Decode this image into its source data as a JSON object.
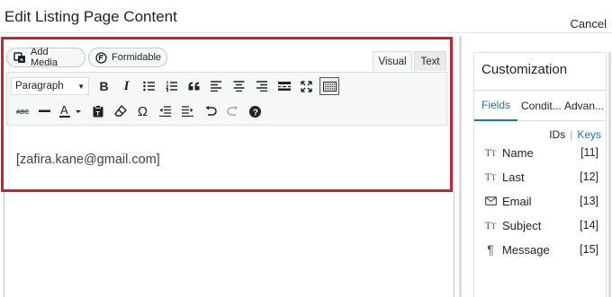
{
  "header": {
    "title": "Edit Listing Page Content",
    "cancel_label": "Cancel"
  },
  "editor": {
    "add_media_label": "Add Media",
    "formidable_label": "Formidable",
    "tabs": {
      "visual": "Visual",
      "text": "Text"
    },
    "format_select": "Paragraph",
    "content": "[zafira.kane@gmail.com]"
  },
  "sidebar": {
    "title": "Customization",
    "tabs": [
      "Fields",
      "Conditionals",
      "Advanced"
    ],
    "tab_display": [
      "Fields",
      "Condit...",
      "Advan..."
    ],
    "ids_label": "IDs",
    "separator": "|",
    "keys_label": "Keys",
    "fields": [
      {
        "name": "Name",
        "id": "[11]",
        "icon": "text-field-icon"
      },
      {
        "name": "Last",
        "id": "[12]",
        "icon": "text-field-icon"
      },
      {
        "name": "Email",
        "id": "[13]",
        "icon": "envelope-icon"
      },
      {
        "name": "Subject",
        "id": "[14]",
        "icon": "text-field-icon"
      },
      {
        "name": "Message",
        "id": "[15]",
        "icon": "paragraph-icon"
      }
    ]
  },
  "colors": {
    "highlight_frame": "#d11f2e",
    "link_blue": "#2271b1"
  }
}
